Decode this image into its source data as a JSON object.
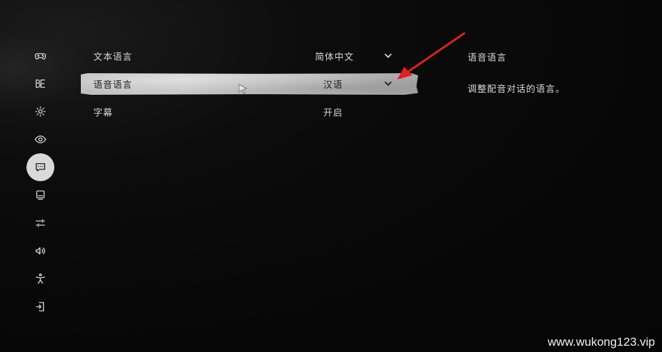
{
  "sidebar": {
    "items": [
      {
        "icon": "gamepad-icon",
        "active": false
      },
      {
        "icon": "display-mode-icon",
        "active": false
      },
      {
        "icon": "gear-icon",
        "active": false
      },
      {
        "icon": "eye-icon",
        "active": false
      },
      {
        "icon": "language-chat-icon",
        "active": true
      },
      {
        "icon": "monitor-icon",
        "active": false
      },
      {
        "icon": "sliders-icon",
        "active": false
      },
      {
        "icon": "speaker-icon",
        "active": false
      },
      {
        "icon": "accessibility-icon",
        "active": false
      },
      {
        "icon": "exit-icon",
        "active": false
      }
    ]
  },
  "settings": {
    "rows": [
      {
        "label": "文本语言",
        "value": "简体中文",
        "has_dropdown": true
      },
      {
        "label": "语音语言",
        "value": "汉语",
        "has_dropdown": true,
        "selected": true
      },
      {
        "label": "字幕",
        "value": "开启",
        "has_dropdown": false
      }
    ]
  },
  "detail": {
    "title": "语音语言",
    "description": "调整配音对话的语言。"
  },
  "annotation": {
    "arrow_color": "#e02020"
  },
  "watermark": "www.wukong123.vip"
}
